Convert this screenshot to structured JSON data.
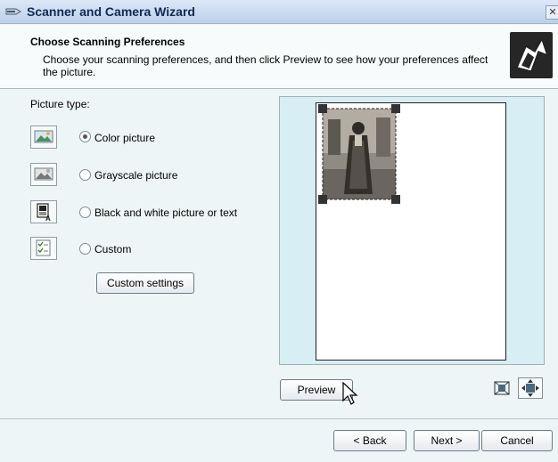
{
  "window": {
    "title": "Scanner and Camera Wizard"
  },
  "header": {
    "title": "Choose Scanning Preferences",
    "description": "Choose your scanning preferences, and then click Preview to see how your preferences affect the picture."
  },
  "picture_type": {
    "label": "Picture type:",
    "options": [
      {
        "label": "Color picture",
        "selected": true,
        "icon": "color-photo-icon"
      },
      {
        "label": "Grayscale picture",
        "selected": false,
        "icon": "grayscale-photo-icon"
      },
      {
        "label": "Black and white picture or text",
        "selected": false,
        "icon": "bw-text-icon"
      },
      {
        "label": "Custom",
        "selected": false,
        "icon": "custom-checklist-icon"
      }
    ]
  },
  "buttons": {
    "custom_settings": "Custom settings",
    "preview": "Preview",
    "back": "< Back",
    "next": "Next >",
    "cancel": "Cancel"
  },
  "colors": {
    "titlebar": "#bcd0ea",
    "preview_bg": "#d6eef4",
    "window_bg": "#eef5f6"
  }
}
